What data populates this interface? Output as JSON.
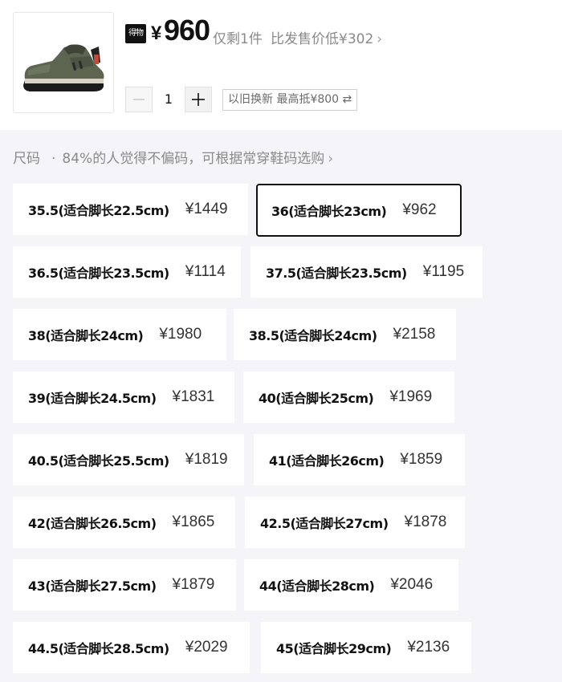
{
  "product": {
    "brand_badge": "得物",
    "price_symbol": "¥",
    "price": "960",
    "stock_text": "仅剩1件",
    "compare_text": "比发售价低¥302",
    "quantity": "1",
    "tradein_text": "以旧换新 最高抵¥800 ⇄"
  },
  "size_section": {
    "label": "尺码",
    "hint": "84%的人觉得不偏码，可根据常穿鞋码选购"
  },
  "sizes": [
    {
      "label": "35.5(适合脚长22.5cm)",
      "price": "¥1449"
    },
    {
      "label": "36(适合脚长23cm)",
      "price": "¥962",
      "selected": true
    },
    {
      "label": "36.5(适合脚长23.5cm)",
      "price": "¥1114"
    },
    {
      "label": "37.5(适合脚长23.5cm)",
      "price": "¥1195"
    },
    {
      "label": "38(适合脚长24cm)",
      "price": "¥1980"
    },
    {
      "label": "38.5(适合脚长24cm)",
      "price": "¥2158"
    },
    {
      "label": "39(适合脚长24.5cm)",
      "price": "¥1831"
    },
    {
      "label": "40(适合脚长25cm)",
      "price": "¥1969"
    },
    {
      "label": "40.5(适合脚长25.5cm)",
      "price": "¥1819"
    },
    {
      "label": "41(适合脚长26cm)",
      "price": "¥1859"
    },
    {
      "label": "42(适合脚长26.5cm)",
      "price": "¥1865"
    },
    {
      "label": "42.5(适合脚长27cm)",
      "price": "¥1878"
    },
    {
      "label": "43(适合脚长27.5cm)",
      "price": "¥1879"
    },
    {
      "label": "44(适合脚长28cm)",
      "price": "¥2046"
    },
    {
      "label": "44.5(适合脚长28.5cm)",
      "price": "¥2029"
    },
    {
      "label": "45(适合脚长29cm)",
      "price": "¥2136"
    }
  ],
  "colors": {
    "selected_border": "#111111",
    "muted_text": "#8a8a8a",
    "page_bg": "#f5f5f9"
  }
}
